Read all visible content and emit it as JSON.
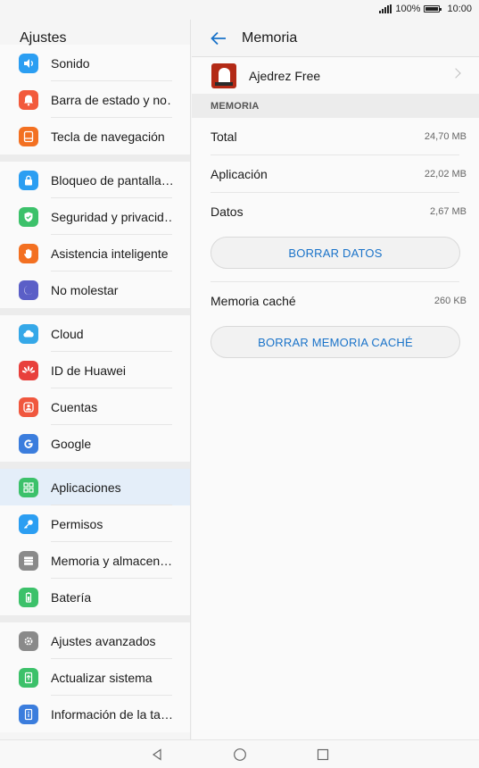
{
  "status": {
    "battery_pct": "100%",
    "time": "10:00"
  },
  "left": {
    "title": "Ajustes",
    "groups": [
      [
        {
          "label": "Sonido",
          "icon": "sound-icon",
          "color": "#2b9ef2"
        },
        {
          "label": "Barra de estado y no…",
          "icon": "notification-bell-icon",
          "color": "#f25a3c"
        },
        {
          "label": "Tecla de navegación",
          "icon": "navigation-key-icon",
          "color": "#f37021"
        }
      ],
      [
        {
          "label": "Bloqueo de pantalla…",
          "icon": "lock-icon",
          "color": "#2b9ef2"
        },
        {
          "label": "Seguridad y privacid…",
          "icon": "shield-icon",
          "color": "#3cc16a"
        },
        {
          "label": "Asistencia inteligente",
          "icon": "hand-icon",
          "color": "#f37021"
        },
        {
          "label": "No molestar",
          "icon": "moon-icon",
          "color": "#5b5fc7"
        }
      ],
      [
        {
          "label": "Cloud",
          "icon": "cloud-icon",
          "color": "#35a8e8"
        },
        {
          "label": "ID de Huawei",
          "icon": "huawei-icon",
          "color": "#e8403c"
        },
        {
          "label": "Cuentas",
          "icon": "account-icon",
          "color": "#f0573e"
        },
        {
          "label": "Google",
          "icon": "google-icon",
          "color": "#3b7ddd"
        }
      ],
      [
        {
          "label": "Aplicaciones",
          "icon": "apps-icon",
          "color": "#3cc16a"
        },
        {
          "label": "Permisos",
          "icon": "key-icon",
          "color": "#2b9ef2"
        },
        {
          "label": "Memoria y almacen…",
          "icon": "storage-icon",
          "color": "#8a8a8a"
        },
        {
          "label": "Batería",
          "icon": "battery-icon",
          "color": "#3cc16a"
        }
      ],
      [
        {
          "label": "Ajustes avanzados",
          "icon": "gear-icon",
          "color": "#8a8a8a"
        },
        {
          "label": "Actualizar sistema",
          "icon": "update-icon",
          "color": "#3cc16a"
        },
        {
          "label": "Información de la ta…",
          "icon": "info-icon",
          "color": "#3b7ddd"
        }
      ]
    ]
  },
  "right": {
    "title": "Memoria",
    "app_name": "Ajedrez Free",
    "section": "MEMORIA",
    "total_label": "Total",
    "total_value": "24,70 MB",
    "app_label": "Aplicación",
    "app_value": "22,02 MB",
    "data_label": "Datos",
    "data_value": "2,67 MB",
    "clear_data": "BORRAR DATOS",
    "cache_label": "Memoria caché",
    "cache_value": "260 KB",
    "clear_cache": "BORRAR MEMORIA CACHÉ"
  },
  "accent": "#1a73c9"
}
